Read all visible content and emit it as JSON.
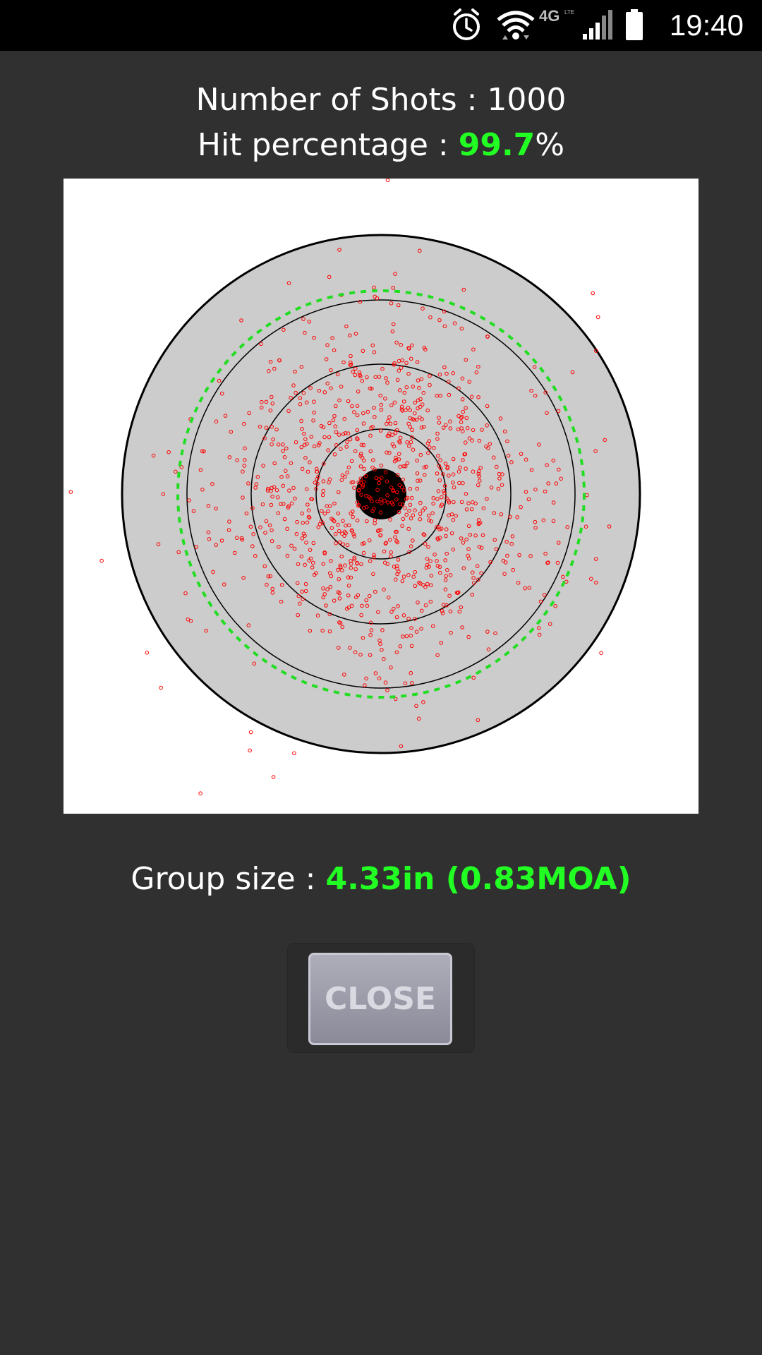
{
  "status_bar": {
    "time": "19:40",
    "network_label": "4G",
    "network_sublabel": "LTE",
    "icons": [
      "alarm-clock-icon",
      "wifi-icon",
      "network-type-icon",
      "cell-signal-icon",
      "battery-icon"
    ]
  },
  "stats": {
    "shots_label": "Number of Shots : ",
    "shots_value": "1000",
    "hit_label": "Hit percentage : ",
    "hit_value": "99.7",
    "hit_suffix": "%",
    "group_label": "Group size : ",
    "group_value": "4.33in  (0.83MOA)"
  },
  "colors": {
    "background": "#303030",
    "highlight": "#22ff22",
    "target_face": "#cccccc",
    "shot_marker": "#ff0000",
    "group_circle": "#22dd22"
  },
  "chart_data": {
    "type": "scatter",
    "title": "",
    "xlabel": "",
    "ylabel": "",
    "ring_count": 4,
    "bullseye": "solid-black-center",
    "group_circle": "green-dashed",
    "shot_count": 1000,
    "points": "randomly-scattered-red-circles",
    "grid": false,
    "legend": "none"
  },
  "close_button": {
    "label": "CLOSE"
  }
}
